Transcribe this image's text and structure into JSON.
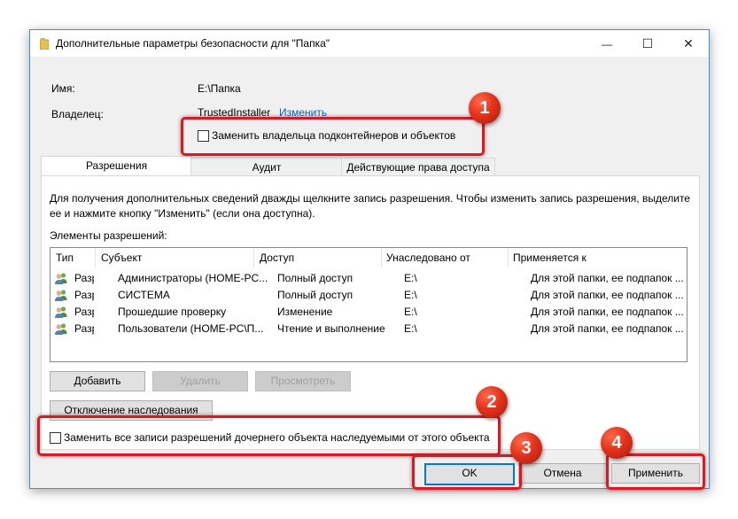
{
  "window": {
    "title": "Дополнительные параметры безопасности  для \"Папка\"",
    "minimize_glyph": "—",
    "maximize_glyph": "☐",
    "close_glyph": "✕"
  },
  "info": {
    "name_label": "Имя:",
    "name_value": "E:\\Папка",
    "owner_label": "Владелец:",
    "owner_value": "TrustedInstaller",
    "owner_change_link": "Изменить",
    "replace_owner_checkbox": "Заменить владельца подконтейнеров и объектов",
    "replace_owner_checked": false
  },
  "tabs": [
    {
      "label": "Разрешения",
      "active": true
    },
    {
      "label": "Аудит",
      "active": false
    },
    {
      "label": "Действующие права доступа",
      "active": false
    }
  ],
  "permissions": {
    "description_line1": "Для получения дополнительных сведений дважды щелкните запись разрешения. Чтобы изменить запись разрешения, выделите",
    "description_line2": "ее и нажмите кнопку \"Изменить\" (если она доступна).",
    "list_label": "Элементы разрешений:",
    "columns": [
      "Тип",
      "Субъект",
      "Доступ",
      "Унаследовано от",
      "Применяется к"
    ],
    "rows": [
      {
        "type": "Разр...",
        "subject": "Администраторы (HOME-PC...",
        "access": "Полный доступ",
        "inherited": "E:\\",
        "applies": "Для этой папки, ее подпапок ..."
      },
      {
        "type": "Разр...",
        "subject": "СИСТЕМА",
        "access": "Полный доступ",
        "inherited": "E:\\",
        "applies": "Для этой папки, ее подпапок ..."
      },
      {
        "type": "Разр...",
        "subject": "Прошедшие проверку",
        "access": "Изменение",
        "inherited": "E:\\",
        "applies": "Для этой папки, ее подпапок ..."
      },
      {
        "type": "Разр...",
        "subject": "Пользователи (HOME-PC\\П...",
        "access": "Чтение и выполнение",
        "inherited": "E:\\",
        "applies": "Для этой папки, ее подпапок ..."
      }
    ],
    "add_button": "Добавить",
    "remove_button": "Удалить",
    "view_button": "Просмотреть",
    "disable_inheritance_button": "Отключение наследования",
    "replace_child_checkbox": "Заменить все записи разрешений дочернего объекта наследуемыми от этого объекта",
    "replace_child_checked": false
  },
  "footer": {
    "ok": "OK",
    "cancel": "Отмена",
    "apply": "Применить"
  },
  "badges": [
    "1",
    "2",
    "3",
    "4"
  ],
  "colors": {
    "accent": "#0078d7",
    "highlight_red": "#e8141d",
    "badge_red": "#e5321b",
    "window_bg": "#f0f0f0",
    "link": "#0066cc"
  },
  "icons": {
    "title": "folder-icon",
    "row": "users-icon",
    "minimize": "minimize-icon",
    "maximize": "maximize-icon",
    "close": "close-icon"
  }
}
